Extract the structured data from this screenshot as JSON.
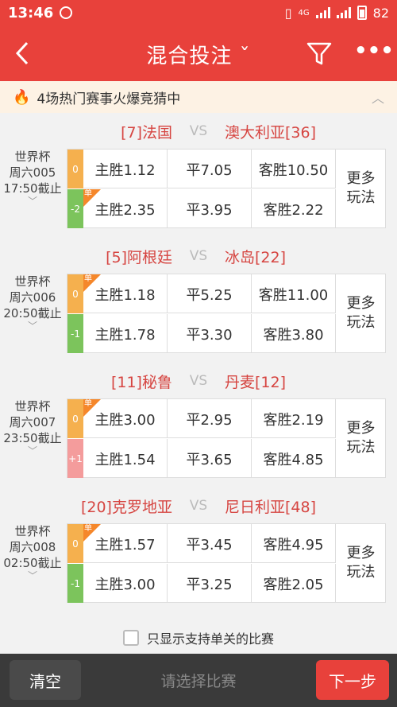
{
  "status_bar": {
    "time": "13:46",
    "battery": "82",
    "network": "4G"
  },
  "header": {
    "title": "混合投注 ˇ",
    "filter_icon": "filter-icon",
    "more_icon": "more-icon",
    "back_icon": "back-arrow-icon"
  },
  "hot_bar": {
    "text": "4场热门赛事火爆竞猜中"
  },
  "colors": {
    "brand": "#e8413b",
    "team": "#d64541",
    "handicap_orange": "#f5b04e",
    "handicap_green": "#7cc45c",
    "handicap_pink": "#f49c9c",
    "single_tag": "#f5872b"
  },
  "matches": [
    {
      "home": "[7]法国",
      "vs": "VS",
      "away": "澳大利亚[36]",
      "league": "世界杯",
      "code": "周六005",
      "deadline": "17:50截止",
      "rows": [
        {
          "handicap": "0",
          "home": "主胜1.12",
          "draw": "平7.05",
          "away": "客胜10.50"
        },
        {
          "handicap": "-2",
          "home": "主胜2.35",
          "draw": "平3.95",
          "away": "客胜2.22"
        }
      ],
      "more": "更多玩法",
      "single_label": "单"
    },
    {
      "home": "[5]阿根廷",
      "vs": "VS",
      "away": "冰岛[22]",
      "league": "世界杯",
      "code": "周六006",
      "deadline": "20:50截止",
      "rows": [
        {
          "handicap": "0",
          "home": "主胜1.18",
          "draw": "平5.25",
          "away": "客胜11.00"
        },
        {
          "handicap": "-1",
          "home": "主胜1.78",
          "draw": "平3.30",
          "away": "客胜3.80"
        }
      ],
      "more": "更多玩法",
      "single_label": "单"
    },
    {
      "home": "[11]秘鲁",
      "vs": "VS",
      "away": "丹麦[12]",
      "league": "世界杯",
      "code": "周六007",
      "deadline": "23:50截止",
      "rows": [
        {
          "handicap": "0",
          "home": "主胜3.00",
          "draw": "平2.95",
          "away": "客胜2.19"
        },
        {
          "handicap": "+1",
          "home": "主胜1.54",
          "draw": "平3.65",
          "away": "客胜4.85"
        }
      ],
      "more": "更多玩法",
      "single_label": "单"
    },
    {
      "home": "[20]克罗地亚",
      "vs": "VS",
      "away": "尼日利亚[48]",
      "league": "世界杯",
      "code": "周六008",
      "deadline": "02:50截止",
      "rows": [
        {
          "handicap": "0",
          "home": "主胜1.57",
          "draw": "平3.45",
          "away": "客胜4.95"
        },
        {
          "handicap": "-1",
          "home": "主胜3.00",
          "draw": "平3.25",
          "away": "客胜2.05"
        }
      ],
      "more": "更多玩法",
      "single_label": "单"
    }
  ],
  "filter": {
    "label": "只显示支持单关的比赛"
  },
  "bottom": {
    "clear": "清空",
    "hint": "请选择比赛",
    "next": "下一步"
  }
}
